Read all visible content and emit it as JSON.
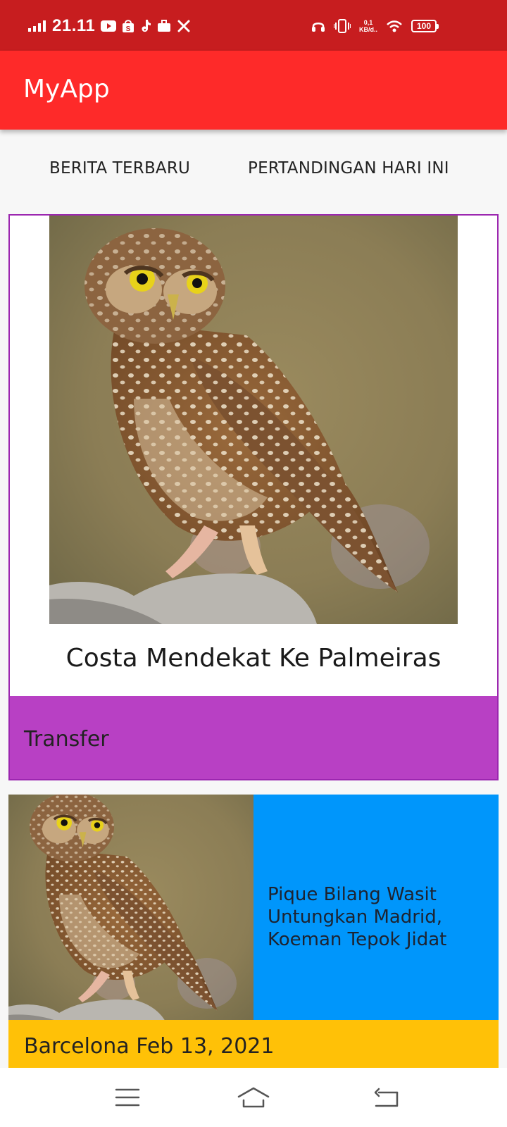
{
  "status_bar": {
    "time": "21.11",
    "net_speed_value": "0,1",
    "net_speed_unit": "KB/d..",
    "battery": "100"
  },
  "app_bar": {
    "title": "MyApp"
  },
  "tabs": [
    {
      "label": "BERITA TERBARU"
    },
    {
      "label": "PERTANDINGAN HARI INI"
    }
  ],
  "cards": [
    {
      "title": "Costa Mendekat Ke Palmeiras",
      "category": "Transfer",
      "band_color": "#b840c4",
      "border_color": "#9c27b0",
      "image": "owl-photo"
    },
    {
      "headline": "Pique Bilang Wasit Untungkan Madrid, Koeman Tepok Jidat",
      "meta": "Barcelona Feb 13, 2021",
      "headline_bg": "#0096fb",
      "band_color": "#ffc107",
      "image": "owl-photo"
    }
  ],
  "nav_bar": {
    "icons": [
      "menu-icon",
      "home-icon",
      "back-icon"
    ]
  },
  "colors": {
    "status_bar": "#c71d1f",
    "app_bar": "#fe2a29"
  }
}
